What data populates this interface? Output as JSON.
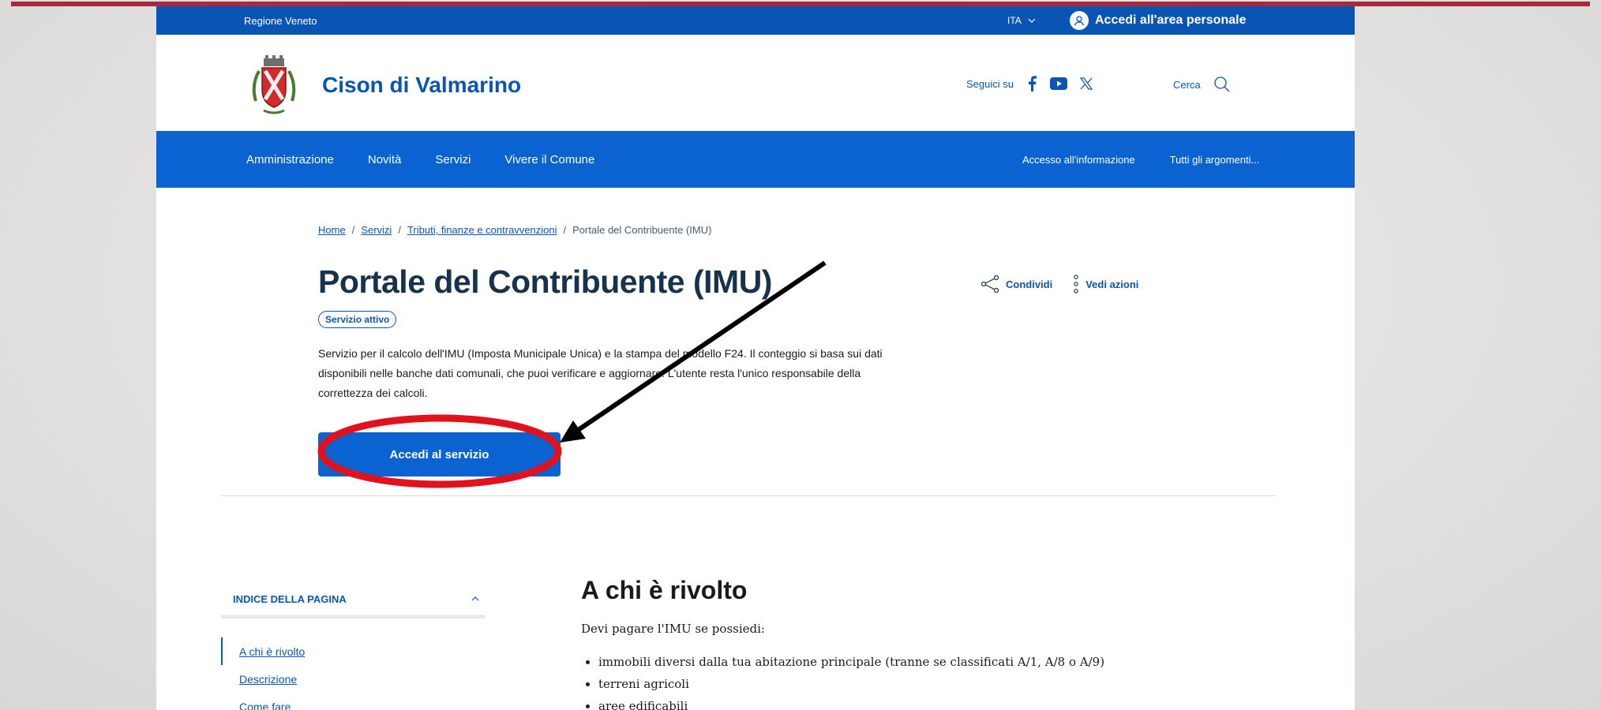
{
  "header": {
    "region": "Regione Veneto",
    "language": "ITA",
    "login_label": "Accedi all'area personale",
    "site_name": "Cison di Valmarino",
    "follow_label": "Seguici su",
    "search_label": "Cerca"
  },
  "nav": {
    "items": [
      "Amministrazione",
      "Novità",
      "Servizi",
      "Vivere il Comune"
    ],
    "side_items": [
      "Accesso all'informazione",
      "Tutti gli argomenti..."
    ]
  },
  "breadcrumb": [
    "Home",
    "Servizi",
    "Tributi, finanze e contravvenzioni",
    "Portale del Contribuente (IMU)"
  ],
  "service": {
    "title": "Portale del Contribuente (IMU)",
    "status_badge": "Servizio attivo",
    "description": "Servizio per il calcolo dell'IMU (Imposta Municipale Unica) e la stampa del modello F24. Il conteggio si basa sui dati disponibili nelle banche dati comunali, che puoi verificare e aggiornare. L'utente resta l'unico responsabile della correttezza dei calcoli.",
    "cta_label": "Accedi al servizio",
    "share_label": "Condividi",
    "actions_label": "Vedi azioni"
  },
  "toc": {
    "title": "INDICE DELLA PAGINA",
    "items": [
      "A chi è rivolto",
      "Descrizione",
      "Come fare"
    ]
  },
  "section": {
    "title": "A chi è rivolto",
    "intro": "Devi pagare l'IMU se possiedi:",
    "list": [
      "immobili diversi dalla tua abitazione principale (tranne se classificati A/1, A/8 o A/9)",
      "terreni agricoli",
      "aree edificabili"
    ]
  },
  "colors": {
    "primary_blue": "#0a55b3",
    "nav_blue": "#0b63d1",
    "annotation_red": "#e2121d",
    "stripe": "#a8283c"
  }
}
